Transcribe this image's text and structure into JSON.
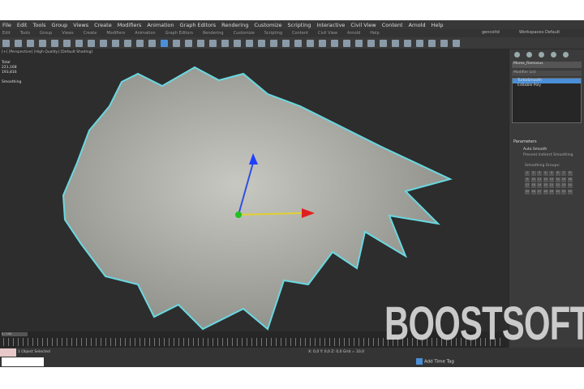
{
  "menu": [
    "File",
    "Edit",
    "Tools",
    "Group",
    "Views",
    "Create",
    "Modifiers",
    "Animation",
    "Graph Editors",
    "Rendering",
    "Customize",
    "Scripting",
    "Interactive",
    "Civil View",
    "Content",
    "Arnold",
    "Help"
  ],
  "submenu": [
    "Edit",
    "Tools",
    "Group",
    "Views",
    "Create",
    "Modifiers",
    "Animation",
    "Graph Editors",
    "Rendering",
    "Customize",
    "Scripting",
    "Content",
    "Civil View",
    "Arnold",
    "Help"
  ],
  "user": "gencoltd",
  "workspace_label": "Workspaces:",
  "workspace": "Default",
  "viewport": {
    "label": "[+] [Perspective] [High Quality] [Default Shading]",
    "stats": [
      "Total",
      "221,168",
      "193,816"
    ],
    "mode": "Smoothing"
  },
  "panel": {
    "object_name": "Murex_Ramosus",
    "modifier_list": "Modifier List",
    "stack": [
      "TurboSmooth",
      "Editable Poly"
    ],
    "params_title": "Parameters",
    "auto_smooth": "Auto Smooth",
    "prevent": "Prevent Indirect Smoothing",
    "groups_label": "Smoothing Groups:",
    "groups": [
      "1",
      "2",
      "3",
      "4",
      "5",
      "6",
      "7",
      "8",
      "9",
      "10",
      "11",
      "12",
      "13",
      "14",
      "15",
      "16",
      "17",
      "18",
      "19",
      "20",
      "21",
      "22",
      "23",
      "24",
      "25",
      "26",
      "27",
      "28",
      "29",
      "30",
      "31",
      "32"
    ]
  },
  "timeline": {
    "frame": "0 / 100"
  },
  "status": {
    "selected": "1 Object Selected",
    "coords": "X: 0,0  Y: 0,0  Z: 0,0  Grid = 10,0",
    "add_time_tag": "Add Time Tag"
  },
  "watermark": "BOOSTSOFT"
}
